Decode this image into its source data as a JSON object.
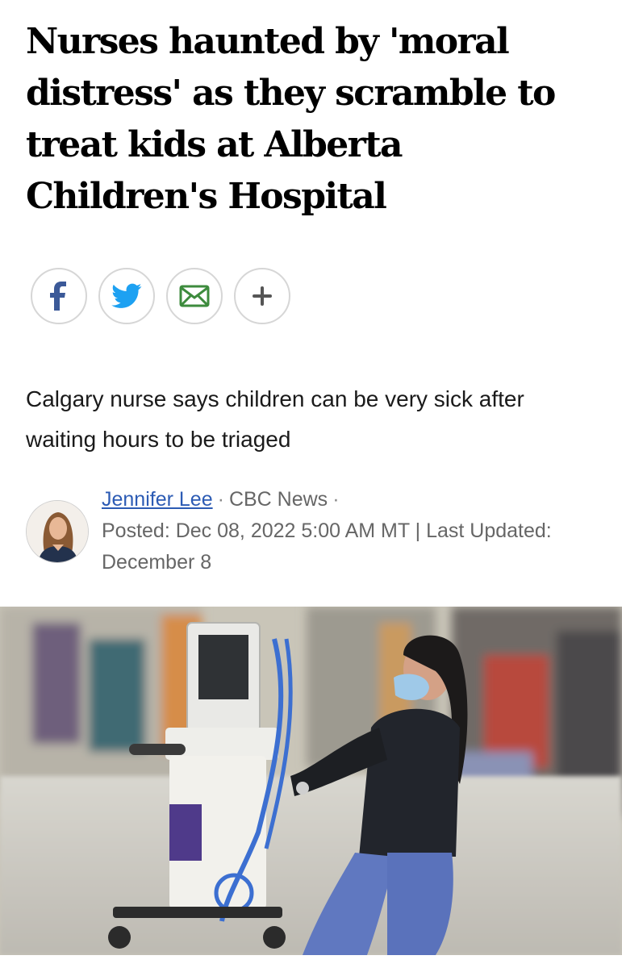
{
  "article": {
    "headline": "Nurses haunted by 'moral distress' as they scramble to treat kids at Alberta Children's Hospital",
    "subheadline": "Calgary nurse says children can be very sick after waiting hours to be triaged",
    "author": "Jennifer Lee",
    "outlet": "CBC News",
    "separator": "·",
    "posted_line": "Posted: Dec 08, 2022 5:00 AM MT | Last Updated: December 8"
  },
  "share": {
    "icons": [
      "facebook-icon",
      "twitter-icon",
      "email-icon",
      "more-share-icon"
    ],
    "colors": {
      "facebook": "#3b5998",
      "twitter": "#1da1f2",
      "email": "#3d8b3d",
      "more": "#555555"
    }
  },
  "colors": {
    "link": "#2c5bb4",
    "headline": "#000000",
    "meta": "#666666"
  }
}
